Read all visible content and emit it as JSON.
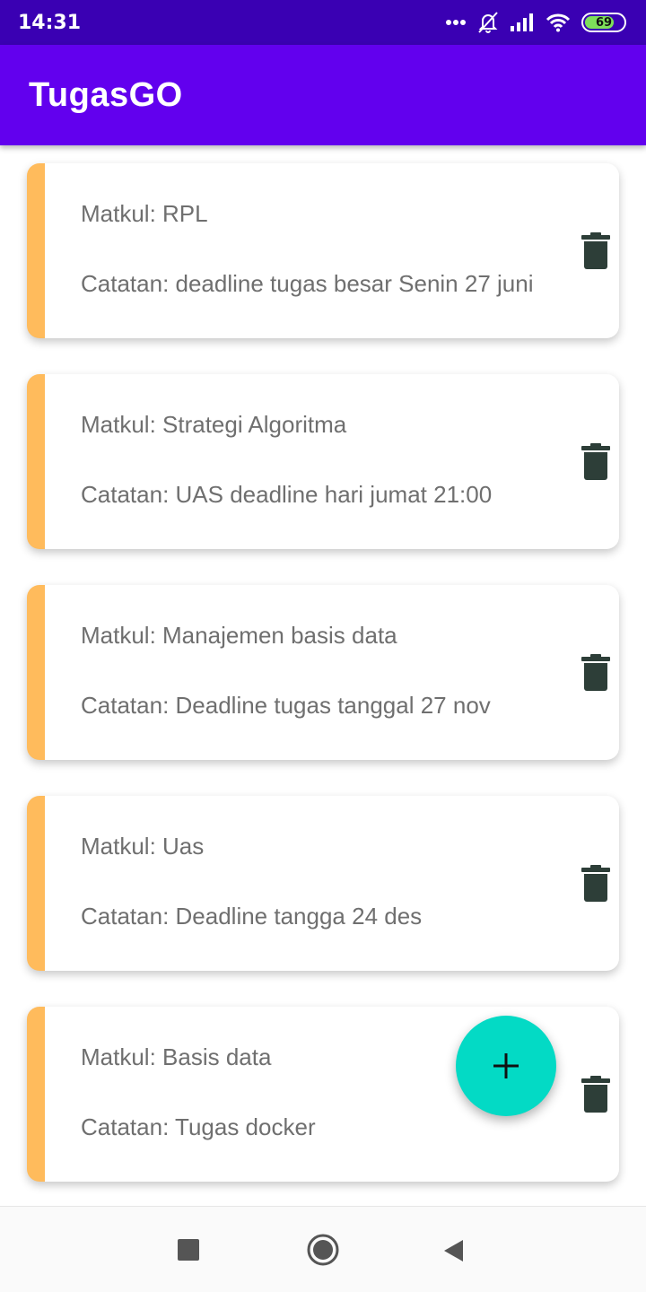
{
  "status_bar": {
    "time": "14:31",
    "battery": "69",
    "icons": [
      "more-dots-icon",
      "bell-muted-icon",
      "signal-icon",
      "wifi-icon",
      "battery-icon"
    ]
  },
  "app": {
    "title": "TugasGO",
    "primary_color": "#6200ee",
    "status_color": "#3a00b3",
    "accent_color": "#03dac5",
    "card_stripe_color": "#ffbb5c"
  },
  "tasks": [
    {
      "matkul": "Matkul: RPL",
      "catatan": "Catatan: deadline tugas besar Senin 27 juni"
    },
    {
      "matkul": "Matkul: Strategi Algoritma",
      "catatan": "Catatan: UAS deadline hari jumat 21:00"
    },
    {
      "matkul": "Matkul: Manajemen basis data",
      "catatan": "Catatan: Deadline tugas tanggal 27 nov"
    },
    {
      "matkul": "Matkul: Uas",
      "catatan": "Catatan: Deadline tangga 24 des"
    },
    {
      "matkul": "Matkul: Basis data",
      "catatan": "Catatan: Tugas docker"
    }
  ],
  "fab": {
    "icon": "plus-icon"
  },
  "nav": {
    "icons": [
      "recents-square-icon",
      "home-circle-icon",
      "back-triangle-icon"
    ]
  }
}
